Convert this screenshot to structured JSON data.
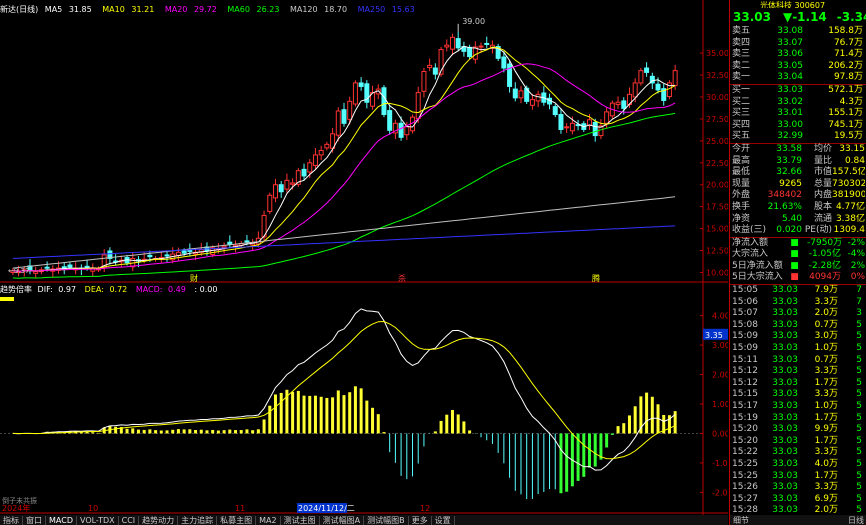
{
  "legend": {
    "title": "新达(日线)",
    "ma5_label": "MA5",
    "ma5": "31.85",
    "ma10_label": "MA10",
    "ma10": "31.21",
    "ma20_label": "MA20",
    "ma20": "29.72",
    "ma60_label": "MA60",
    "ma60": "26.23",
    "ma120_label": "MA120",
    "ma120": "18.70",
    "ma250_label": "MA250",
    "ma250": "15.63"
  },
  "macd_legend": {
    "name": "趋势倍率",
    "dif_label": "DIF:",
    "dif": "0.97",
    "dea_label": "DEA:",
    "dea": "0.72",
    "macd_label": "MACD:",
    "macd": "0.49",
    "extra": ": 0.00"
  },
  "chart_data": [
    {
      "type": "candlestick",
      "title": "新达(日线)",
      "y_ticks": [
        "35.00",
        "32.50",
        "30.00",
        "27.50",
        "25.00",
        "22.50",
        "20.00",
        "17.50",
        "15.00",
        "12.50",
        "10.00"
      ],
      "ylim": [
        9.37,
        39.0
      ],
      "annotations": {
        "high": "39.00",
        "low": "9.37",
        "markers": [
          "财",
          "杀",
          "腾"
        ]
      },
      "series": [
        {
          "name": "MA5",
          "color": "#ffffff"
        },
        {
          "name": "MA10",
          "color": "#ffff00"
        },
        {
          "name": "MA20",
          "color": "#ff00ff"
        },
        {
          "name": "MA60",
          "color": "#00ff00"
        },
        {
          "name": "MA120",
          "color": "#c0c0c0"
        },
        {
          "name": "MA250",
          "color": "#3333ff"
        }
      ],
      "closes": [
        10.2,
        10.1,
        10.3,
        10.2,
        10.1,
        10.3,
        10.6,
        10.4,
        10.5,
        10.4,
        10.6,
        10.5,
        10.4,
        10.6,
        10.5,
        10.4,
        12.0,
        11.6,
        11.2,
        11.4,
        11.1,
        11.6,
        11.3,
        11.5,
        11.8,
        11.6,
        11.7,
        11.9,
        12.1,
        12.3,
        12.2,
        12.4,
        12.3,
        12.6,
        12.5,
        12.8,
        12.7,
        13.0,
        13.2,
        13.1,
        13.3,
        13.6,
        13.4,
        13.9,
        16.5,
        18.8,
        20.0,
        19.2,
        20.5,
        20.2,
        21.6,
        21.0,
        22.5,
        23.4,
        23.9,
        24.6,
        25.8,
        28.4,
        27.0,
        29.5,
        31.6,
        31.2,
        29.4,
        30.5,
        30.9,
        28.0,
        26.2,
        27.0,
        25.4,
        26.6,
        27.7,
        30.5,
        32.9,
        33.6,
        32.6,
        35.4,
        35.9,
        36.8,
        35.6,
        35.2,
        34.6,
        35.7,
        35.8,
        36.0,
        35.9,
        34.4,
        33.3,
        31.2,
        29.9,
        30.7,
        29.5,
        29.7,
        30.3,
        29.4,
        29.2,
        28.0,
        26.3,
        26.6,
        27.0,
        26.8,
        26.3,
        27.4,
        25.6,
        26.7,
        28.3,
        29.3,
        29.4,
        28.7,
        30.3,
        31.6,
        33.0,
        32.8,
        31.6,
        30.8,
        29.6,
        31.6,
        33.0
      ],
      "macd_ticks": [
        "4.00",
        "3.00",
        "2.00",
        "1.00",
        "0.00",
        "-1.00",
        "-2.00"
      ],
      "macd_last": "3.35"
    }
  ],
  "bottom_dates": {
    "d1": "2024年",
    "d2": "10",
    "d3": "11",
    "d4": "2024/11/12/二",
    "d5": "12"
  },
  "bottom_note": "倒子未共振",
  "tabs": [
    "指标",
    "窗口",
    "MACD",
    "VOL-TDX",
    "CCI",
    "趋势动力",
    "主力追踪",
    "私募主图",
    "MA2",
    "测试主图",
    "测试幅图A",
    "测试幅图B",
    "更多",
    "设置"
  ],
  "right": {
    "header": "光体科技 300607",
    "price": "33.03",
    "change": "▼-1.14",
    "pct": "-3.34%",
    "asks": [
      {
        "label": "卖五",
        "price": "33.08",
        "vol": "158.8万"
      },
      {
        "label": "卖四",
        "price": "33.07",
        "vol": "76.7万"
      },
      {
        "label": "卖三",
        "price": "33.06",
        "vol": "71.4万"
      },
      {
        "label": "卖二",
        "price": "33.05",
        "vol": "206.2万"
      },
      {
        "label": "卖一",
        "price": "33.04",
        "vol": "97.8万"
      }
    ],
    "bids": [
      {
        "label": "买一",
        "price": "33.03",
        "vol": "572.1万"
      },
      {
        "label": "买二",
        "price": "33.02",
        "vol": "4.3万"
      },
      {
        "label": "买三",
        "price": "33.01",
        "vol": "155.1万"
      },
      {
        "label": "买四",
        "price": "33.00",
        "vol": "745.1万"
      },
      {
        "label": "买五",
        "price": "32.99",
        "vol": "19.5万"
      }
    ],
    "stats": [
      {
        "k1": "今开",
        "v1": "33.58",
        "k2": "均价",
        "v2": "33.15"
      },
      {
        "k1": "最高",
        "v1": "33.79",
        "k2": "量比",
        "v2": "0.84"
      },
      {
        "k1": "最低",
        "v1": "32.66",
        "k2": "市值",
        "v2": "157.5亿"
      },
      {
        "k1": "现量",
        "v1": "9265",
        "k2": "总量",
        "v2": "730302"
      },
      {
        "k1": "外盘",
        "v1": "348402",
        "k2": "内盘",
        "v2": "381900"
      },
      {
        "k1": "换手",
        "v1": "21.63%",
        "k2": "股本",
        "v2": "4.77亿"
      },
      {
        "k1": "净资",
        "v1": "5.40",
        "k2": "流通",
        "v2": "3.38亿"
      },
      {
        "k1": "收益(三)",
        "v1": "0.020",
        "k2": "PE(动)",
        "v2": "1309.4"
      }
    ],
    "flows": [
      {
        "label": "净流入额",
        "val": "-7950万",
        "pct": "-2%"
      },
      {
        "label": "大宗流入",
        "val": "-1.05亿",
        "pct": "-4%"
      },
      {
        "label": "5日净流入额",
        "val": "-2.28亿",
        "pct": "2%"
      },
      {
        "label": "5日大宗流入",
        "val": "4094万",
        "pct": "0%"
      }
    ],
    "ticks": [
      {
        "t": "15:05",
        "p": "33.03",
        "v": "7.9万",
        "n": "7"
      },
      {
        "t": "15:06",
        "p": "33.03",
        "v": "3.3万",
        "n": "7"
      },
      {
        "t": "15:07",
        "p": "33.03",
        "v": "2.0万",
        "n": "3"
      },
      {
        "t": "15:08",
        "p": "33.03",
        "v": "0.7万",
        "n": "5"
      },
      {
        "t": "15:09",
        "p": "33.03",
        "v": "3.0万",
        "n": "5"
      },
      {
        "t": "15:09",
        "p": "33.03",
        "v": "1.0万",
        "n": "5"
      },
      {
        "t": "15:11",
        "p": "33.03",
        "v": "0.7万",
        "n": "5"
      },
      {
        "t": "15:12",
        "p": "33.03",
        "v": "3.3万",
        "n": "5"
      },
      {
        "t": "15:12",
        "p": "33.03",
        "v": "1.7万",
        "n": "5"
      },
      {
        "t": "15:15",
        "p": "33.03",
        "v": "3.3万",
        "n": "5"
      },
      {
        "t": "15:17",
        "p": "33.03",
        "v": "1.0万",
        "n": "5"
      },
      {
        "t": "15:19",
        "p": "33.03",
        "v": "1.7万",
        "n": "5"
      },
      {
        "t": "15:20",
        "p": "33.03",
        "v": "9.9万",
        "n": "5"
      },
      {
        "t": "15:20",
        "p": "33.03",
        "v": "1.7万",
        "n": "5"
      },
      {
        "t": "15:22",
        "p": "33.03",
        "v": "3.3万",
        "n": "5"
      },
      {
        "t": "15:25",
        "p": "33.03",
        "v": "4.0万",
        "n": "5"
      },
      {
        "t": "15:25",
        "p": "33.03",
        "v": "1.7万",
        "n": "5"
      },
      {
        "t": "15:26",
        "p": "33.03",
        "v": "3.3万",
        "n": "5"
      },
      {
        "t": "15:27",
        "p": "33.03",
        "v": "6.9万",
        "n": "5"
      },
      {
        "t": "15:28",
        "p": "33.03",
        "v": "2.0万",
        "n": "5"
      },
      {
        "t": "15:29",
        "p": "33.03",
        "v": "1.0万",
        "n": "5"
      }
    ],
    "foot_left": "细节",
    "foot_right": "日线"
  }
}
